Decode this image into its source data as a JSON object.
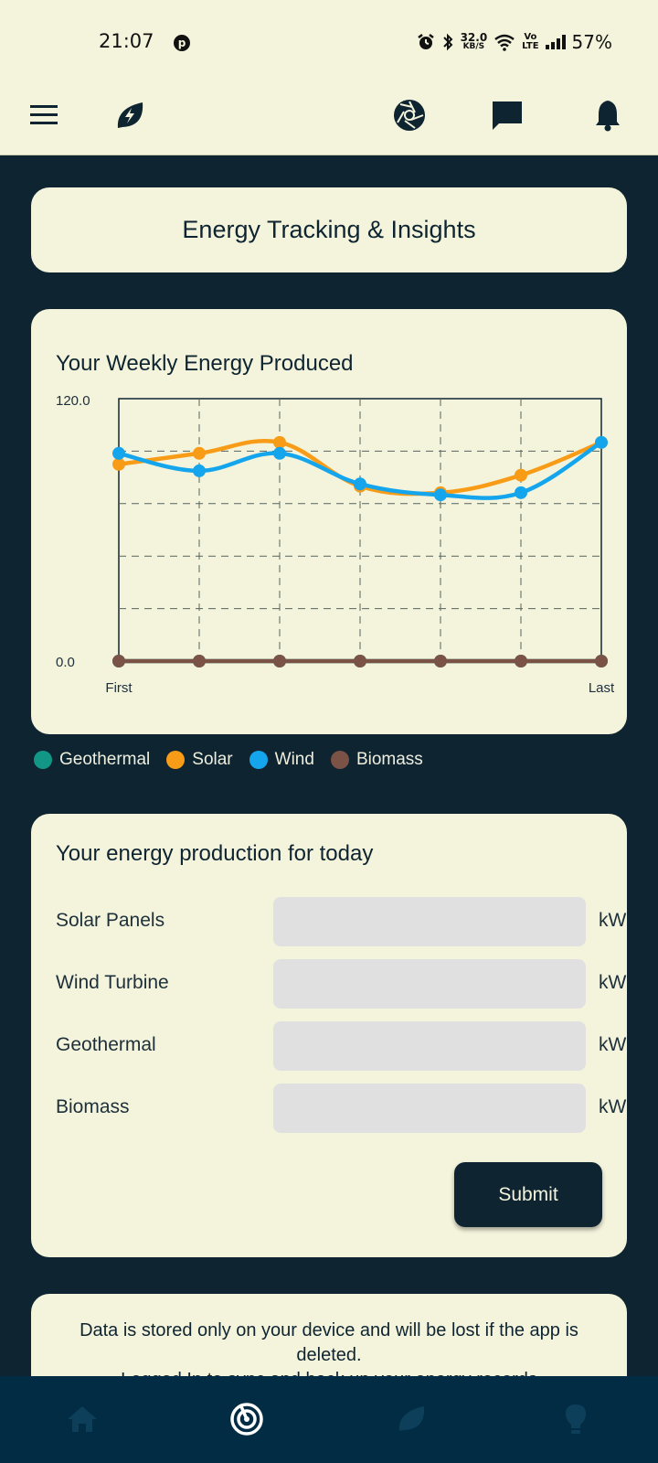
{
  "status_bar": {
    "time": "21:07",
    "speed_value": "32.0",
    "speed_unit": "KB/S",
    "volte_top": "Vo",
    "volte_bottom": "LTE",
    "battery": "57%"
  },
  "icons": {
    "menu": "menu-icon",
    "app_logo": "leaf-bolt-icon",
    "aperture": "aperture-icon",
    "chat": "chat-icon",
    "notifications": "bell-icon",
    "home": "home-icon",
    "dashboard": "target-icon",
    "eco": "leaf-icon",
    "tips": "lightbulb-icon"
  },
  "colors": {
    "background": "#0e2431",
    "card": "#f4f4dc",
    "geothermal": "#129787",
    "solar": "#f89c17",
    "wind": "#15a5ec",
    "biomass": "#7a5246",
    "nav_background": "#022c43"
  },
  "page_title": "Energy Tracking & Insights",
  "chart_data": {
    "type": "line",
    "title": "Your Weekly Energy Produced",
    "x_labels": [
      "First",
      "",
      "",
      "",
      "",
      "",
      "Last"
    ],
    "x_tick_first": "First",
    "x_tick_last": "Last",
    "y_tick_max": "120.0",
    "y_tick_min": "0.0",
    "ylim": [
      0,
      120
    ],
    "grid": true,
    "legend_position": "bottom",
    "series": [
      {
        "name": "Geothermal",
        "color": "#129787",
        "values": [
          0,
          0,
          0,
          0,
          0,
          0,
          0
        ]
      },
      {
        "name": "Solar",
        "color": "#f89c17",
        "values": [
          90,
          95,
          100,
          80,
          77,
          85,
          100
        ]
      },
      {
        "name": "Wind",
        "color": "#15a5ec",
        "values": [
          95,
          87,
          95,
          81,
          76,
          77,
          100
        ]
      },
      {
        "name": "Biomass",
        "color": "#7a5246",
        "values": [
          0,
          0,
          0,
          0,
          0,
          0,
          0
        ]
      }
    ]
  },
  "legend": [
    {
      "label": "Geothermal",
      "color": "#129787"
    },
    {
      "label": "Solar",
      "color": "#f89c17"
    },
    {
      "label": "Wind",
      "color": "#15a5ec"
    },
    {
      "label": "Biomass",
      "color": "#7a5246"
    }
  ],
  "form": {
    "title": "Your energy production for today",
    "rows": [
      {
        "label": "Solar Panels",
        "value": "",
        "unit": "kW"
      },
      {
        "label": "Wind Turbine",
        "value": "",
        "unit": "kW"
      },
      {
        "label": "Geothermal",
        "value": "",
        "unit": "kW"
      },
      {
        "label": "Biomass",
        "value": "",
        "unit": "kW"
      }
    ],
    "submit_label": "Submit"
  },
  "info": {
    "text": "Data is stored only on your device and will be lost if the app is deleted.",
    "text2": "Logged In to sync and back up your energy records"
  }
}
